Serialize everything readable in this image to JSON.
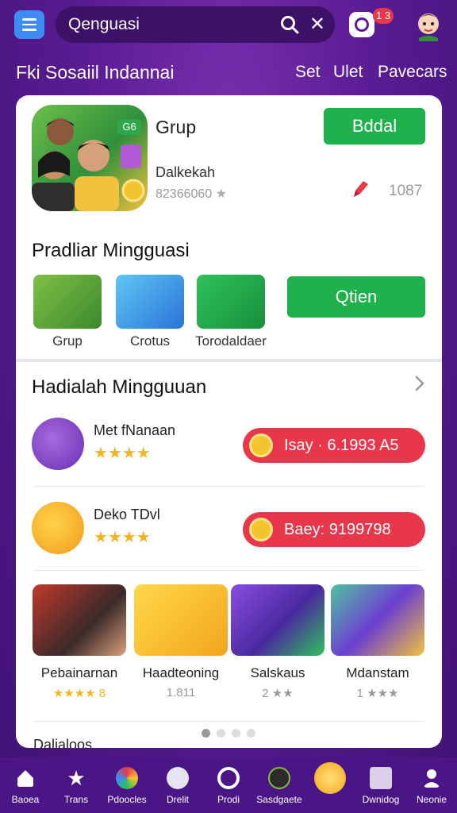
{
  "topbar": {
    "search_value": "Qenguasi",
    "cam_badge": "1 3"
  },
  "subnav": {
    "brand": "Fki Sosaiil Indannai",
    "links": [
      "Set",
      "Ulet",
      "Pavecars"
    ]
  },
  "featured": {
    "title": "Grup",
    "badge": "G6",
    "subtitle": "Dalkekah",
    "meta": "82366060",
    "button": "Bddal",
    "count": "1087"
  },
  "section1": {
    "title": "Pradliar Mingguasi",
    "items": [
      {
        "label": "Grup"
      },
      {
        "label": "Crotus"
      },
      {
        "label": "Torodaldaer"
      }
    ],
    "button": "Qtien"
  },
  "section2": {
    "title": "Hadialah Mingguuan",
    "rewards": [
      {
        "name": "Met fNanaan",
        "stars": "★★★★",
        "pill_text": "Isay · 6.1993 A5"
      },
      {
        "name": "Deko TDvl",
        "stars": "★★★★",
        "pill_text": "Baey: 9199798"
      }
    ],
    "apps": [
      {
        "name": "Pebainarnan",
        "rating": "★★★★ 8"
      },
      {
        "name": "Haadteoning",
        "rating": "1.811"
      },
      {
        "name": "Salskaus",
        "rating": "2 ★★"
      },
      {
        "name": "Mdanstam",
        "rating": "1 ★★★"
      }
    ]
  },
  "bottom_peek": "Dalialoos",
  "bottomnav": [
    {
      "label": "Baoea",
      "icon": "home-icon"
    },
    {
      "label": "Trans",
      "icon": "star-icon"
    },
    {
      "label": "Pdoocles",
      "icon": "palette-icon"
    },
    {
      "label": "Drelit",
      "icon": "smiley-icon"
    },
    {
      "label": "Prodi",
      "icon": "target-icon"
    },
    {
      "label": "Sasdgaete",
      "icon": "game-icon"
    },
    {
      "label": "",
      "icon": "coin-icon"
    },
    {
      "label": "Dwnidog",
      "icon": "mail-icon"
    },
    {
      "label": "Neonie",
      "icon": "profile-icon"
    }
  ],
  "colors": {
    "background": "#5a1c94",
    "accent_green": "#1fb14b",
    "accent_red": "#e8364a",
    "star": "#f3b51c"
  }
}
